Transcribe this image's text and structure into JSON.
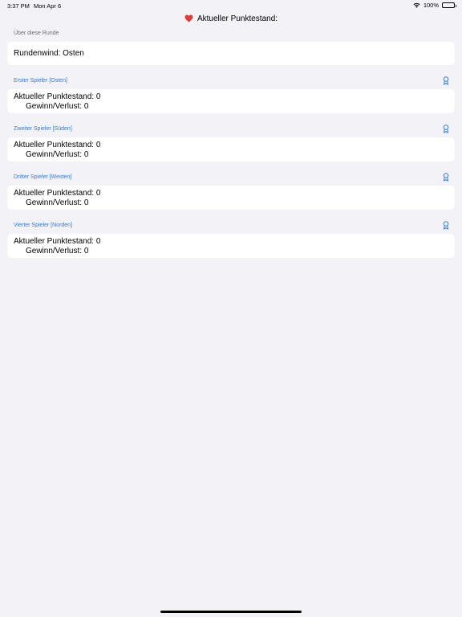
{
  "status_bar": {
    "time": "3:37 PM",
    "date": "Mon Apr 6",
    "battery": "100%",
    "icons": [
      "wifi-icon",
      "battery-icon"
    ]
  },
  "nav": {
    "title": "Aktueller Punktestand:",
    "icon": "heart-icon",
    "icon_color": "#e53935"
  },
  "round": {
    "header": "Über diese Runde",
    "wind_label": "Rundenwind: Osten"
  },
  "players": [
    {
      "header": "Erster Spieler [Osten]",
      "score": "Aktueller Punktestand: 0",
      "gain": "Gewinn/Verlust: 0"
    },
    {
      "header": "Zweiter Spieler [Süden]",
      "score": "Aktueller Punktestand: 0",
      "gain": "Gewinn/Verlust: 0"
    },
    {
      "header": "Dritter Spieler [Westen]",
      "score": "Aktueller Punktestand: 0",
      "gain": "Gewinn/Verlust: 0"
    },
    {
      "header": "Vierter Spieler [Norden]",
      "score": "Aktueller Punktestand: 0",
      "gain": "Gewinn/Verlust: 0"
    }
  ],
  "colors": {
    "accent": "#2f7bf5",
    "background": "#f2f2f7",
    "card": "#ffffff"
  }
}
